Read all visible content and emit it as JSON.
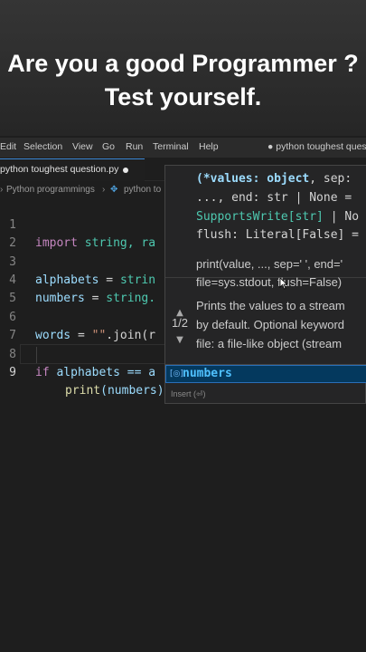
{
  "caption": {
    "line1": "Are you a good Programmer ?",
    "line2": "Test yourself."
  },
  "menubar": {
    "items": [
      "Edit",
      "Selection",
      "View",
      "Go",
      "Run",
      "Terminal",
      "Help"
    ],
    "window_title": "● python toughest questio"
  },
  "tab": {
    "label": "python toughest question.py"
  },
  "breadcrumb": {
    "folder": "Python programmings",
    "file": "python to"
  },
  "editor": {
    "lines": [
      {
        "n": "1",
        "a": "import",
        "b": " string, ra"
      },
      {
        "n": "2"
      },
      {
        "n": "3",
        "a": "alphabets",
        "b": " = ",
        "c": "strin"
      },
      {
        "n": "4",
        "a": "numbers",
        "b": " = ",
        "c": "string."
      },
      {
        "n": "5"
      },
      {
        "n": "6",
        "a": "words",
        "b": " = ",
        "c": "\"\"",
        "d": ".join(r"
      },
      {
        "n": "7"
      },
      {
        "n": "8",
        "a": "if",
        "b": " alphabets == a"
      },
      {
        "n": "9",
        "a": "print",
        "b": "(numbers)"
      }
    ]
  },
  "hover": {
    "sig_line1_p": "(*values: object",
    "sig_line1_rest": ", sep:",
    "sig_line2": "..., end: str | None =",
    "sig_line3_t": "SupportsWrite[str]",
    "sig_line3_rest": " | No",
    "sig_line4": "flush: Literal[False] =",
    "doc1": "print(value, ..., sep=' ', end='",
    "doc2": "file=sys.stdout, flush=False)",
    "doc3": "Prints the values to a stream",
    "doc4": "by default. Optional keyword",
    "doc5": "file: a file-like object (stream",
    "paging": "1/2"
  },
  "suggest": {
    "item": "numbers",
    "hint": "Insert (⏎)",
    "icon": "variable-icon"
  }
}
